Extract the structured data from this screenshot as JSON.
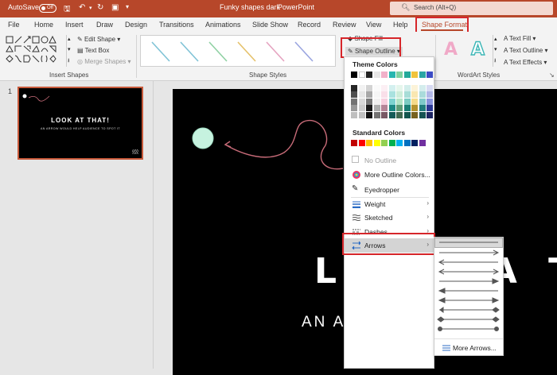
{
  "titlebar": {
    "autosave_label": "AutoSave",
    "autosave_state": "Off",
    "doc_title": "Funky shapes dark",
    "separator": "-",
    "app_name": "PowerPoint",
    "search_placeholder": "Search (Alt+Q)"
  },
  "menu_tabs": [
    "File",
    "Home",
    "Insert",
    "Draw",
    "Design",
    "Transitions",
    "Animations",
    "Slide Show",
    "Record",
    "Review",
    "View",
    "Help",
    "Shape Format"
  ],
  "ribbon": {
    "edit_shape": "Edit Shape",
    "text_box": "Text Box",
    "merge_shapes": "Merge Shapes",
    "group_insert_shapes": "Insert Shapes",
    "shape_fill": "Shape Fill",
    "shape_outline": "Shape Outline",
    "group_shape_styles": "Shape Styles",
    "text_fill": "Text Fill",
    "text_outline": "Text Outline",
    "text_effects": "Text Effects",
    "group_wordart": "WordArt Styles"
  },
  "colors": {
    "accent": "#b7472a",
    "highlight": "#d6262a",
    "gallery_line": "#7fc3d6",
    "theme_row": [
      "#000000",
      "#ffffff",
      "#222222",
      "#e7e6e6",
      "#f1b0c9",
      "#27b6b0",
      "#7fd2a0",
      "#23a99a",
      "#f0c33c",
      "#2aa5a5",
      "#3b4bc4"
    ],
    "standard_row": [
      "#c00000",
      "#ff0000",
      "#ffc000",
      "#ffff00",
      "#92d050",
      "#00b050",
      "#00b0f0",
      "#0070c0",
      "#002060",
      "#7030a0"
    ],
    "arrow_color": "#c76b78",
    "circle_fill": "#c6f2df"
  },
  "thumbnail": {
    "number": "1",
    "title": "LOOK AT THAT!",
    "subtitle": "AN ARROW WOULD HELP AUDIENCE TO SPOT IT"
  },
  "slide": {
    "title": "LOOK AT THAT!",
    "title_visible": "L O O   A T",
    "subtitle_visible": "AN ARROW W   HELP"
  },
  "dropdown": {
    "theme_header": "Theme Colors",
    "standard_header": "Standard Colors",
    "no_outline": "No Outline",
    "more_colors": "More Outline Colors...",
    "eyedropper": "Eyedropper",
    "weight": "Weight",
    "sketched": "Sketched",
    "dashes": "Dashes",
    "arrows": "Arrows"
  },
  "arrows_submenu": {
    "more_arrows": "More Arrows..."
  }
}
